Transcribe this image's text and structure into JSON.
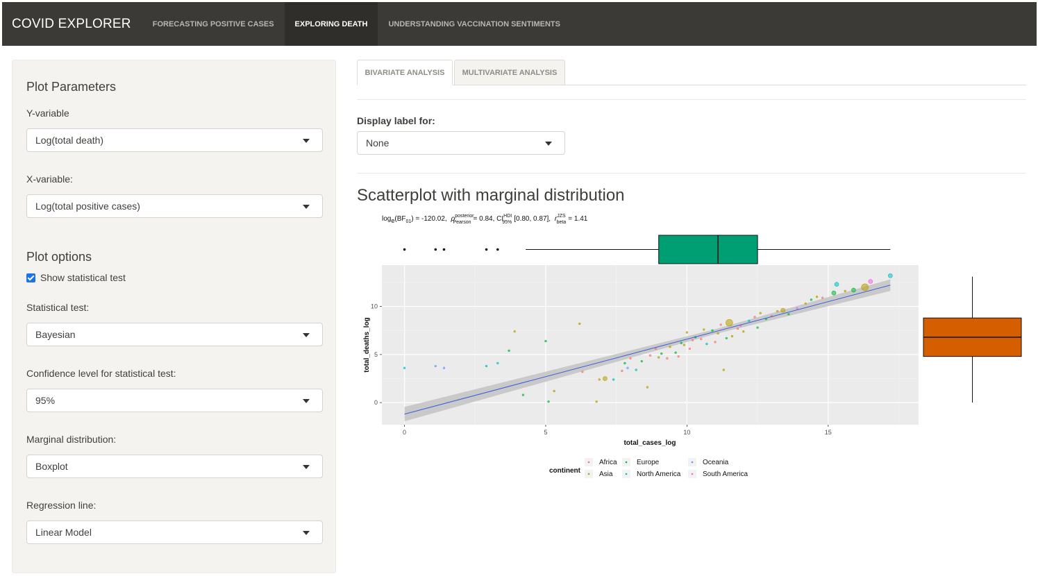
{
  "navbar": {
    "brand": "COVID EXPLORER",
    "items": [
      {
        "label": "FORECASTING POSITIVE CASES",
        "active": false
      },
      {
        "label": "EXPLORING DEATH",
        "active": true
      },
      {
        "label": "UNDERSTANDING VACCINATION SENTIMENTS",
        "active": false
      }
    ]
  },
  "sidebar": {
    "plot_parameters_heading": "Plot Parameters",
    "y_variable_label": "Y-variable",
    "y_variable_value": "Log(total death)",
    "x_variable_label": "X-variable:",
    "x_variable_value": "Log(total positive cases)",
    "plot_options_heading": "Plot options",
    "show_stat_test_label": "Show statistical test",
    "show_stat_test_checked": true,
    "stat_test_label": "Statistical test:",
    "stat_test_value": "Bayesian",
    "confidence_label": "Confidence level for statistical test:",
    "confidence_value": "95%",
    "marginal_label": "Marginal distribution:",
    "marginal_value": "Boxplot",
    "regression_label": "Regression line:",
    "regression_value": "Linear Model"
  },
  "main": {
    "tabs": [
      {
        "label": "BIVARIATE ANALYSIS",
        "active": true
      },
      {
        "label": "MULTIVARIATE ANALYSIS",
        "active": false
      }
    ],
    "display_label_for": "Display label for:",
    "display_label_value": "None",
    "plot_title": "Scatterplot with marginal distribution"
  },
  "chart_data": {
    "type": "scatter",
    "subtitle_parts": {
      "log_bf": "log",
      "log_bf_sub": "e",
      "bf_text": "(BF",
      "bf_sub": "01",
      "bf_value": ") = -120.02,",
      "rho_sup": "posterior",
      "rho_sub": "Pearson",
      "rho_value": "= 0.84, CI",
      "ci_sup": "HDI",
      "ci_sub": "95%",
      "ci_value": "[0.80, 0.87],",
      "r_sup": "JZS",
      "r_sub": "beta",
      "r_value": "= 1.41"
    },
    "xlabel": "total_cases_log",
    "ylabel": "total_deaths_log",
    "xlim": [
      -0.8,
      18.2
    ],
    "ylim": [
      -2.3,
      14.3
    ],
    "xticks": [
      0,
      5,
      10,
      15
    ],
    "yticks": [
      0,
      5,
      10
    ],
    "grid": true,
    "legend": {
      "title": "continent",
      "position": "bottom",
      "entries": [
        {
          "name": "Africa",
          "color": "#f8766d"
        },
        {
          "name": "Asia",
          "color": "#b79f00"
        },
        {
          "name": "Europe",
          "color": "#00ba38"
        },
        {
          "name": "North America",
          "color": "#00bfc4"
        },
        {
          "name": "Oceania",
          "color": "#619cff"
        },
        {
          "name": "South America",
          "color": "#f564e3"
        }
      ]
    },
    "regression": {
      "intercept": -1.2,
      "slope": 0.78,
      "color": "#3b5bdb",
      "band_color": "#c3c3c3"
    },
    "marginal_x": {
      "min": 3.8,
      "q1": 9.0,
      "median": 11.1,
      "q3": 12.5,
      "max": 17.2,
      "outliers": [
        0,
        1.1,
        1.4,
        2.9,
        3.3
      ],
      "fill": "#009e73"
    },
    "marginal_y": {
      "min": 0,
      "q1": 4.8,
      "median": 6.8,
      "q3": 8.8,
      "max": 13.1,
      "fill": "#d55e00"
    },
    "points": [
      {
        "x": 0,
        "y": 3.6,
        "c": "North America",
        "s": 1
      },
      {
        "x": 1.1,
        "y": 3.8,
        "c": "Oceania",
        "s": 1
      },
      {
        "x": 1.4,
        "y": 3.6,
        "c": "Oceania",
        "s": 1
      },
      {
        "x": 2.9,
        "y": 3.8,
        "c": "North America",
        "s": 1
      },
      {
        "x": 3.3,
        "y": 4.1,
        "c": "North America",
        "s": 1
      },
      {
        "x": 3.7,
        "y": 5.4,
        "c": "Europe",
        "s": 1
      },
      {
        "x": 3.9,
        "y": 7.4,
        "c": "Asia",
        "s": 1
      },
      {
        "x": 4.2,
        "y": 0.8,
        "c": "Europe",
        "s": 1
      },
      {
        "x": 5.0,
        "y": 6.4,
        "c": "Europe",
        "s": 1
      },
      {
        "x": 5.1,
        "y": 0.1,
        "c": "Europe",
        "s": 1
      },
      {
        "x": 5.3,
        "y": 1.2,
        "c": "Asia",
        "s": 1
      },
      {
        "x": 6.2,
        "y": 8.2,
        "c": "Asia",
        "s": 1
      },
      {
        "x": 6.3,
        "y": 3.2,
        "c": "Africa",
        "s": 1
      },
      {
        "x": 6.8,
        "y": 0.1,
        "c": "Asia",
        "s": 1
      },
      {
        "x": 6.9,
        "y": 2.4,
        "c": "Asia",
        "s": 1
      },
      {
        "x": 7.1,
        "y": 2.5,
        "c": "Asia",
        "s": 2
      },
      {
        "x": 7.4,
        "y": 2.4,
        "c": "North America",
        "s": 1
      },
      {
        "x": 7.7,
        "y": 3.3,
        "c": "Africa",
        "s": 1
      },
      {
        "x": 7.8,
        "y": 4.1,
        "c": "Europe",
        "s": 1
      },
      {
        "x": 7.9,
        "y": 3.6,
        "c": "Oceania",
        "s": 1
      },
      {
        "x": 8.0,
        "y": 4.6,
        "c": "Africa",
        "s": 1
      },
      {
        "x": 8.2,
        "y": 3.4,
        "c": "North America",
        "s": 1
      },
      {
        "x": 8.4,
        "y": 4.3,
        "c": "Europe",
        "s": 1
      },
      {
        "x": 8.6,
        "y": 1.6,
        "c": "Asia",
        "s": 1
      },
      {
        "x": 8.7,
        "y": 4.9,
        "c": "Africa",
        "s": 1
      },
      {
        "x": 8.9,
        "y": 5.6,
        "c": "Africa",
        "s": 1
      },
      {
        "x": 9.0,
        "y": 4.7,
        "c": "Asia",
        "s": 1
      },
      {
        "x": 9.1,
        "y": 5.1,
        "c": "Europe",
        "s": 1
      },
      {
        "x": 9.3,
        "y": 4.6,
        "c": "Africa",
        "s": 1
      },
      {
        "x": 9.4,
        "y": 5.8,
        "c": "Asia",
        "s": 1
      },
      {
        "x": 9.6,
        "y": 5.2,
        "c": "Europe",
        "s": 1
      },
      {
        "x": 9.7,
        "y": 4.8,
        "c": "Africa",
        "s": 1
      },
      {
        "x": 9.8,
        "y": 6.2,
        "c": "Europe",
        "s": 1
      },
      {
        "x": 9.9,
        "y": 6.0,
        "c": "Asia",
        "s": 1
      },
      {
        "x": 10.0,
        "y": 7.3,
        "c": "Asia",
        "s": 1
      },
      {
        "x": 10.1,
        "y": 5.6,
        "c": "Africa",
        "s": 1
      },
      {
        "x": 10.2,
        "y": 6.5,
        "c": "Africa",
        "s": 1
      },
      {
        "x": 10.3,
        "y": 6.8,
        "c": "Europe",
        "s": 1
      },
      {
        "x": 10.5,
        "y": 6.6,
        "c": "Africa",
        "s": 1
      },
      {
        "x": 10.6,
        "y": 7.6,
        "c": "Asia",
        "s": 1
      },
      {
        "x": 10.7,
        "y": 6.1,
        "c": "North America",
        "s": 1
      },
      {
        "x": 10.9,
        "y": 7.5,
        "c": "Europe",
        "s": 1
      },
      {
        "x": 11.0,
        "y": 6.3,
        "c": "Africa",
        "s": 1
      },
      {
        "x": 11.1,
        "y": 7.2,
        "c": "Asia",
        "s": 1
      },
      {
        "x": 11.2,
        "y": 8.1,
        "c": "Africa",
        "s": 1
      },
      {
        "x": 11.3,
        "y": 3.4,
        "c": "Asia",
        "s": 1
      },
      {
        "x": 11.4,
        "y": 6.7,
        "c": "Europe",
        "s": 1
      },
      {
        "x": 11.5,
        "y": 8.3,
        "c": "Asia",
        "s": 3
      },
      {
        "x": 11.6,
        "y": 6.9,
        "c": "Asia",
        "s": 1
      },
      {
        "x": 11.8,
        "y": 7.7,
        "c": "Africa",
        "s": 1
      },
      {
        "x": 11.9,
        "y": 8.0,
        "c": "South America",
        "s": 1
      },
      {
        "x": 12.0,
        "y": 7.4,
        "c": "Asia",
        "s": 1
      },
      {
        "x": 12.2,
        "y": 8.5,
        "c": "North America",
        "s": 1
      },
      {
        "x": 12.4,
        "y": 8.9,
        "c": "Africa",
        "s": 1
      },
      {
        "x": 12.5,
        "y": 7.8,
        "c": "Europe",
        "s": 1
      },
      {
        "x": 12.6,
        "y": 9.3,
        "c": "Asia",
        "s": 1
      },
      {
        "x": 12.8,
        "y": 8.7,
        "c": "Europe",
        "s": 1
      },
      {
        "x": 13.0,
        "y": 9.0,
        "c": "Africa",
        "s": 1
      },
      {
        "x": 13.2,
        "y": 9.5,
        "c": "Asia",
        "s": 1
      },
      {
        "x": 13.4,
        "y": 9.6,
        "c": "Asia",
        "s": 2
      },
      {
        "x": 13.6,
        "y": 9.2,
        "c": "Europe",
        "s": 1
      },
      {
        "x": 13.9,
        "y": 9.8,
        "c": "South America",
        "s": 1
      },
      {
        "x": 14.2,
        "y": 10.3,
        "c": "Asia",
        "s": 1
      },
      {
        "x": 14.4,
        "y": 10.7,
        "c": "Europe",
        "s": 1
      },
      {
        "x": 14.6,
        "y": 11.0,
        "c": "Asia",
        "s": 1
      },
      {
        "x": 14.8,
        "y": 10.9,
        "c": "Africa",
        "s": 1
      },
      {
        "x": 15.2,
        "y": 11.4,
        "c": "Europe",
        "s": 2
      },
      {
        "x": 15.3,
        "y": 12.3,
        "c": "North America",
        "s": 2
      },
      {
        "x": 15.6,
        "y": 11.6,
        "c": "Asia",
        "s": 1
      },
      {
        "x": 15.9,
        "y": 11.7,
        "c": "Europe",
        "s": 2
      },
      {
        "x": 16.3,
        "y": 12.0,
        "c": "Asia",
        "s": 3
      },
      {
        "x": 16.5,
        "y": 12.6,
        "c": "South America",
        "s": 2
      },
      {
        "x": 17.2,
        "y": 13.2,
        "c": "North America",
        "s": 2
      }
    ]
  }
}
